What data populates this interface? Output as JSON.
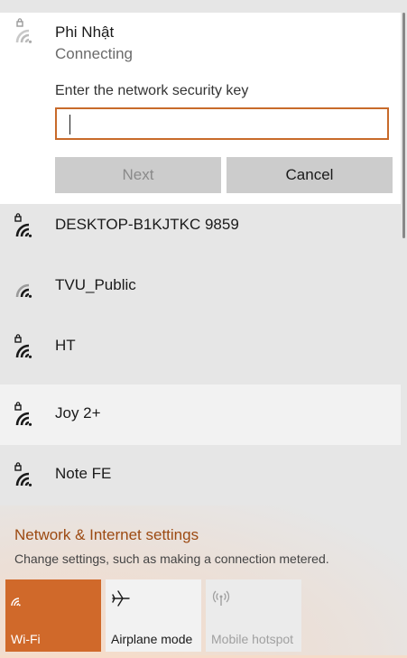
{
  "active_network": {
    "name": "Phi Nhật",
    "status": "Connecting",
    "prompt": "Enter the network security key",
    "key_value": "",
    "next_label": "Next",
    "cancel_label": "Cancel",
    "secured": true
  },
  "networks": [
    {
      "name": "DESKTOP-B1KJTKC 9859",
      "secured": true,
      "icon": "wifi-lock-icon"
    },
    {
      "name": "TVU_Public",
      "secured": false,
      "icon": "wifi-icon"
    },
    {
      "name": "HT",
      "secured": true,
      "icon": "wifi-lock-icon"
    },
    {
      "name": "Joy 2+",
      "secured": true,
      "icon": "wifi-lock-icon"
    },
    {
      "name": "Note FE",
      "secured": true,
      "icon": "wifi-lock-icon"
    }
  ],
  "settings": {
    "title": "Network & Internet settings",
    "subtitle": "Change settings, such as making a connection metered."
  },
  "quick_actions": {
    "wifi": {
      "label": "Wi-Fi",
      "active": true
    },
    "airplane": {
      "label": "Airplane mode",
      "active": false
    },
    "hotspot": {
      "label": "Mobile hotspot",
      "active": false,
      "disabled": true
    }
  },
  "colors": {
    "accent": "#d0692a",
    "link": "#9c4a12",
    "input_border": "#c86a2a"
  }
}
